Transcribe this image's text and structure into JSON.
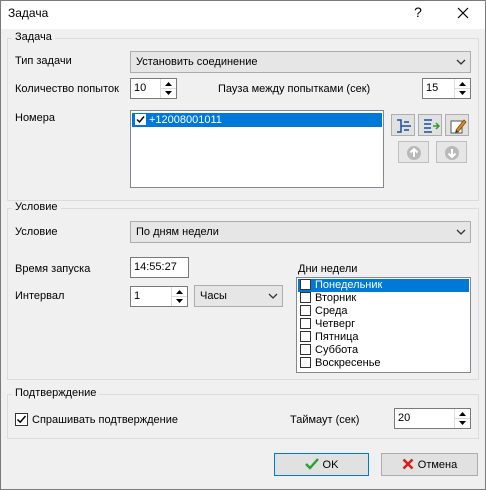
{
  "window": {
    "title": "Задача",
    "help_label": "?"
  },
  "task_group": {
    "label": "Задача",
    "type_label": "Тип задачи",
    "type_value": "Установить соединение",
    "attempts_label": "Количество попыток",
    "attempts_value": "10",
    "pause_label": "Пауза между попытками (сек)",
    "pause_value": "15",
    "numbers_label": "Номера",
    "numbers": [
      {
        "value": "+12008001011",
        "checked": true,
        "selected": true
      }
    ],
    "tools": [
      "add-number-icon",
      "import-numbers-icon",
      "edit-number-icon",
      "move-up-icon",
      "move-down-icon"
    ]
  },
  "condition_group": {
    "label": "Условие",
    "condition_label": "Условие",
    "condition_value": "По дням недели",
    "start_time_label": "Время запуска",
    "start_time_value": "14:55:27",
    "interval_label": "Интервал",
    "interval_value": "1",
    "interval_unit": "Часы",
    "weekdays_label": "Дни недели",
    "weekdays": [
      {
        "name": "Понедельник",
        "checked": false,
        "selected": true
      },
      {
        "name": "Вторник",
        "checked": false,
        "selected": false
      },
      {
        "name": "Среда",
        "checked": false,
        "selected": false
      },
      {
        "name": "Четверг",
        "checked": false,
        "selected": false
      },
      {
        "name": "Пятница",
        "checked": false,
        "selected": false
      },
      {
        "name": "Суббота",
        "checked": false,
        "selected": false
      },
      {
        "name": "Воскресенье",
        "checked": false,
        "selected": false
      }
    ]
  },
  "confirm_group": {
    "label": "Подтверждение",
    "ask_label": "Спрашивать подтверждение",
    "ask_checked": true,
    "timeout_label": "Таймаут (сек)",
    "timeout_value": "20"
  },
  "buttons": {
    "ok_label": "OK",
    "cancel_label": "Отмена"
  },
  "colors": {
    "selection": "#0078d7",
    "ok_check": "#2e9e2e",
    "cancel_x": "#d32020"
  }
}
